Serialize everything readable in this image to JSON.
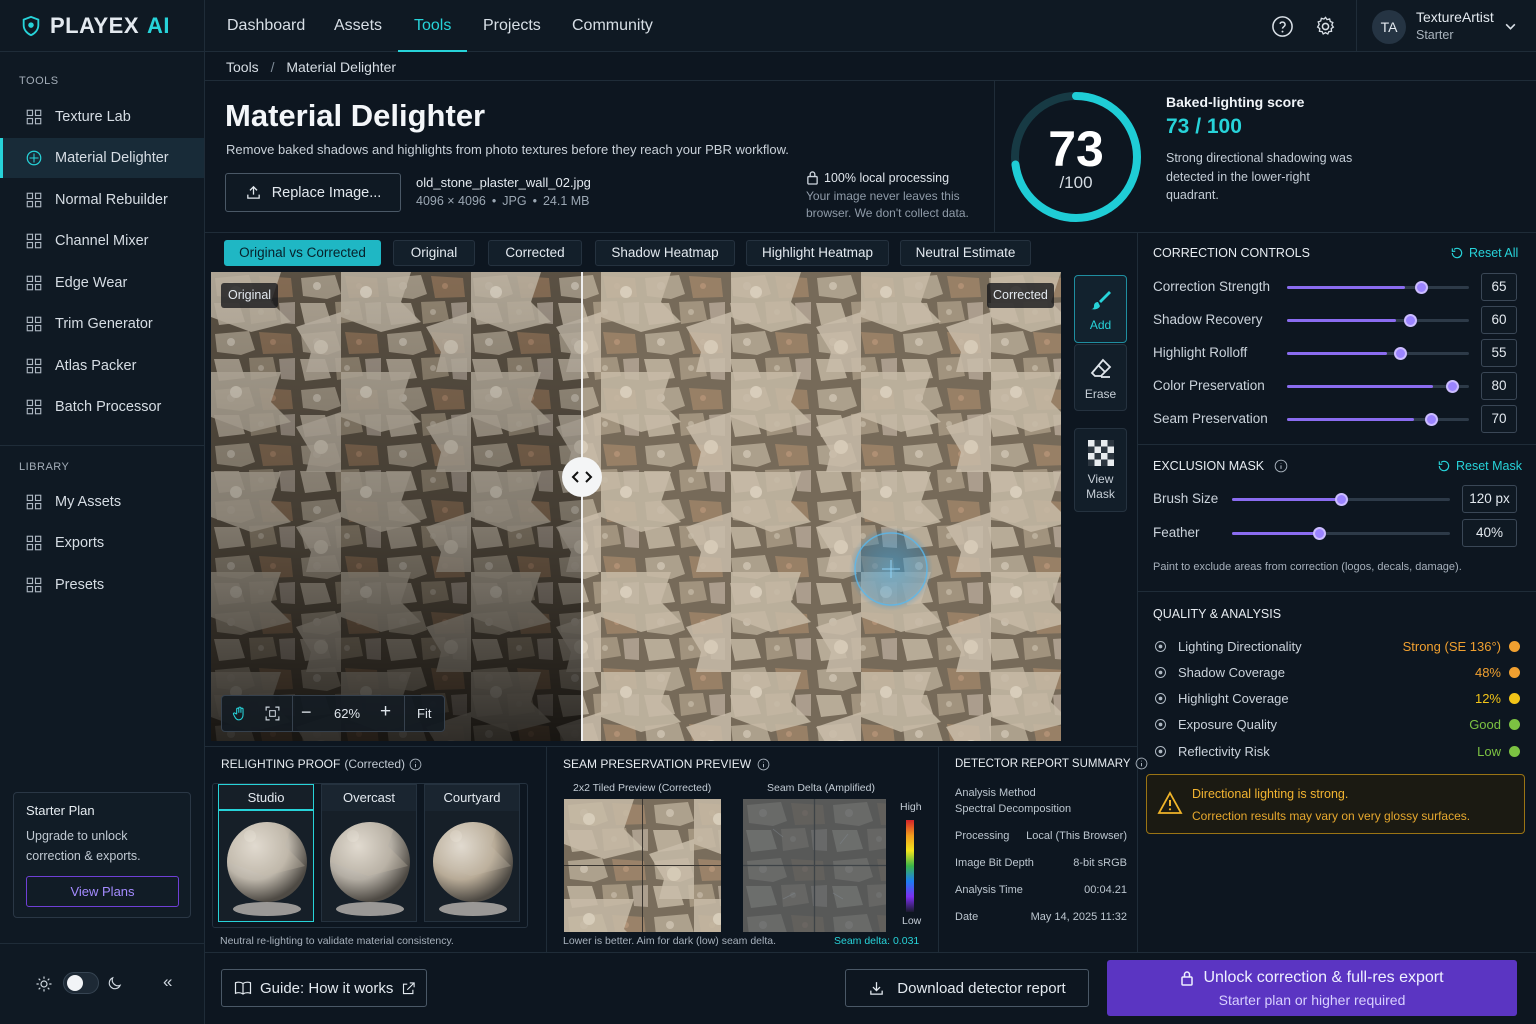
{
  "app": {
    "logo_text": "PLAYEX",
    "logo_accent": "AI",
    "accent_color": "#27d3d9",
    "purple_color": "#6f3fd6"
  },
  "nav": {
    "items": [
      "Dashboard",
      "Assets",
      "Tools",
      "Projects",
      "Community"
    ],
    "active": "Tools"
  },
  "user": {
    "initials": "TA",
    "name": "TextureArtist",
    "plan": "Starter"
  },
  "sidebar": {
    "tools_label": "TOOLS",
    "tools": [
      {
        "label": "Texture Lab",
        "icon": "texture-icon"
      },
      {
        "label": "Material Delighter",
        "icon": "delighter-icon",
        "active": true
      },
      {
        "label": "Normal Rebuilder",
        "icon": "normal-icon"
      },
      {
        "label": "Channel Mixer",
        "icon": "channel-icon"
      },
      {
        "label": "Edge Wear",
        "icon": "edge-icon"
      },
      {
        "label": "Trim Generator",
        "icon": "trim-icon"
      },
      {
        "label": "Atlas Packer",
        "icon": "atlas-icon"
      },
      {
        "label": "Batch Processor",
        "icon": "batch-icon"
      }
    ],
    "library_label": "LIBRARY",
    "library": [
      {
        "label": "My Assets",
        "icon": "assets-icon"
      },
      {
        "label": "Exports",
        "icon": "exports-icon"
      },
      {
        "label": "Presets",
        "icon": "presets-icon"
      }
    ],
    "plan_card": {
      "title": "Starter Plan",
      "text": "Upgrade to unlock correction & exports.",
      "button": "View Plans"
    }
  },
  "breadcrumb": {
    "root": "Tools",
    "sep": "/",
    "current": "Material Delighter"
  },
  "header": {
    "title": "Material Delighter",
    "subtitle": "Remove baked shadows and highlights from photo textures before they reach your PBR workflow.",
    "replace_button": "Replace Image...",
    "file_name": "old_stone_plaster_wall_02.jpg",
    "file_dims": "4096 × 4096",
    "file_type": "JPG",
    "file_size": "24.1 MB",
    "dot": "•",
    "privacy_title": "100% local processing",
    "privacy_text": "Your image never leaves this browser. We don't collect data."
  },
  "score": {
    "value": 73,
    "max_text": "/100",
    "label": "Baked-lighting score",
    "display": "73 / 100",
    "description": "Strong directional shadowing was detected in the lower-right quadrant."
  },
  "view_tabs": [
    "Original vs Corrected",
    "Original",
    "Corrected",
    "Shadow Heatmap",
    "Highlight Heatmap",
    "Neutral Estimate"
  ],
  "viewer": {
    "label_left": "Original",
    "label_right": "Corrected",
    "zoom": "62%",
    "fit": "Fit",
    "minus": "−",
    "plus": "+"
  },
  "side_tools": [
    {
      "label": "Add",
      "icon": "brush-icon"
    },
    {
      "label": "Erase",
      "icon": "eraser-icon"
    },
    {
      "label": "View Mask",
      "icon": "checker-icon"
    }
  ],
  "correction": {
    "title": "CORRECTION CONTROLS",
    "reset": "Reset All",
    "sliders": [
      {
        "label": "Correction Strength",
        "value": 65
      },
      {
        "label": "Shadow Recovery",
        "value": 60
      },
      {
        "label": "Highlight Rolloff",
        "value": 55
      },
      {
        "label": "Color Preservation",
        "value": 80
      },
      {
        "label": "Seam Preservation",
        "value": 70
      }
    ]
  },
  "mask": {
    "title": "EXCLUSION MASK",
    "reset": "Reset Mask",
    "brush_label": "Brush Size",
    "brush_value": "120 px",
    "brush_level": 0.5,
    "feather_label": "Feather",
    "feather_value": "40%",
    "feather_level": 0.4,
    "hint": "Paint to exclude areas from correction (logos, decals, damage)."
  },
  "quality": {
    "title": "QUALITY & ANALYSIS",
    "rows": [
      {
        "label": "Lighting Directionality",
        "value": "Strong (SE 136°)",
        "color": "#f0a030",
        "icon": "sun-icon"
      },
      {
        "label": "Shadow Coverage",
        "value": "48%",
        "color": "#f0a030",
        "icon": "shadow-icon"
      },
      {
        "label": "Highlight Coverage",
        "value": "12%",
        "color": "#f2c418",
        "icon": "highlight-icon"
      },
      {
        "label": "Exposure Quality",
        "value": "Good",
        "color": "#7cc242",
        "icon": "exposure-icon"
      },
      {
        "label": "Reflectivity Risk",
        "value": "Low",
        "color": "#7cc242",
        "icon": "reflect-icon"
      }
    ]
  },
  "warning": {
    "title": "Directional lighting is strong.",
    "text": "Correction results may vary on very glossy surfaces."
  },
  "relight": {
    "title": "RELIGHTING PROOF",
    "suffix": "(Corrected)",
    "tabs": [
      "Studio",
      "Overcast",
      "Courtyard"
    ],
    "caption": "Neutral re-lighting to validate material consistency."
  },
  "seam": {
    "title": "SEAM PRESERVATION PREVIEW",
    "left_label": "2x2 Tiled Preview (Corrected)",
    "right_label": "Seam Delta (Amplified)",
    "high": "High",
    "low": "Low",
    "caption": "Lower is better. Aim for dark (low) seam delta.",
    "delta_label": "Seam delta:",
    "delta_value": "0.031"
  },
  "report": {
    "title": "DETECTOR REPORT SUMMARY",
    "method_label": "Analysis Method",
    "method_value": "Spectral Decomposition",
    "rows": [
      {
        "k": "Processing",
        "v": "Local (This Browser)"
      },
      {
        "k": "Image Bit Depth",
        "v": "8-bit sRGB"
      },
      {
        "k": "Analysis Time",
        "v": "00:04.21"
      },
      {
        "k": "Date",
        "v": "May 14, 2025  11:32"
      }
    ]
  },
  "footer": {
    "guide": "Guide: How it works",
    "download": "Download detector report",
    "unlock_title": "Unlock correction & full-res export",
    "unlock_sub": "Starter plan or higher required"
  }
}
